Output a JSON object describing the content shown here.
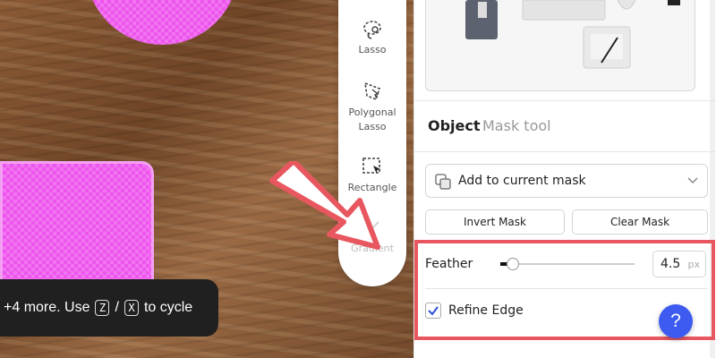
{
  "canvas": {
    "mask_color": "#ee55ee"
  },
  "tools": {
    "lasso": {
      "label": "Lasso",
      "icon": "lasso-icon"
    },
    "polygonal_lasso": {
      "label": "Polygonal\nLasso",
      "icon": "polygonal-lasso-icon"
    },
    "rectangle": {
      "label": "Rectangle",
      "icon": "rectangle-select-icon"
    },
    "gradient": {
      "label": "Gradient",
      "icon": "gradient-icon",
      "disabled": true
    }
  },
  "toast": {
    "prefix": "+4 more. Use",
    "key1": "Z",
    "separator": "/",
    "key2": "X",
    "suffix": "to cycle"
  },
  "panel": {
    "tabs": [
      {
        "label": "Object",
        "active": true
      },
      {
        "label": "Mask tool",
        "active": false
      }
    ],
    "mask_mode": {
      "selected": "Add to current mask",
      "icon": "add-mask-icon"
    },
    "buttons": {
      "invert": "Invert Mask",
      "clear": "Clear Mask"
    },
    "feather": {
      "label": "Feather",
      "value": "4.5",
      "unit": "px",
      "slider_fraction": 0.09
    },
    "refine_edge": {
      "label": "Refine Edge",
      "checked": true
    }
  },
  "help": {
    "label": "?"
  },
  "colors": {
    "accent": "#3d5af1",
    "highlight": "#e8575f",
    "arrow": "#e8575f"
  }
}
